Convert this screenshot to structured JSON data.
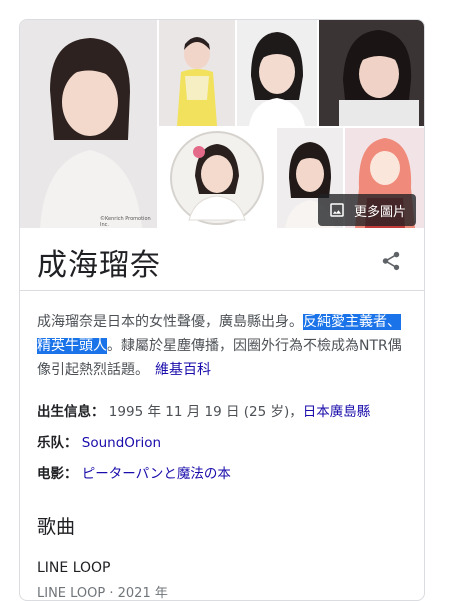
{
  "gallery": {
    "credit": "©Kenrich Promotion Inc.",
    "more_photos_label": "更多圖片"
  },
  "entity": {
    "name": "成海瑠奈"
  },
  "description": {
    "text_1": "成海瑠奈是日本的女性聲優，廣島縣出身。",
    "highlight": "反純愛主義者、精英牛頭人",
    "text_2": "。隸屬於星塵傳播，因圈外行為不檢成為NTR偶像引起熱烈話題。",
    "source_link": "維基百科"
  },
  "facts": [
    {
      "key": "出生信息：",
      "value": "1995 年 11 月 19 日 (25 岁)，",
      "link": "日本廣島縣"
    },
    {
      "key": "乐队：",
      "value": "",
      "link": "SoundOrion"
    },
    {
      "key": "电影：",
      "value": "",
      "link": "ピーターパンと魔法の本"
    }
  ],
  "songs": {
    "heading": "歌曲",
    "items": [
      {
        "title": "LINE LOOP",
        "meta": "LINE LOOP · 2021 年"
      }
    ]
  }
}
